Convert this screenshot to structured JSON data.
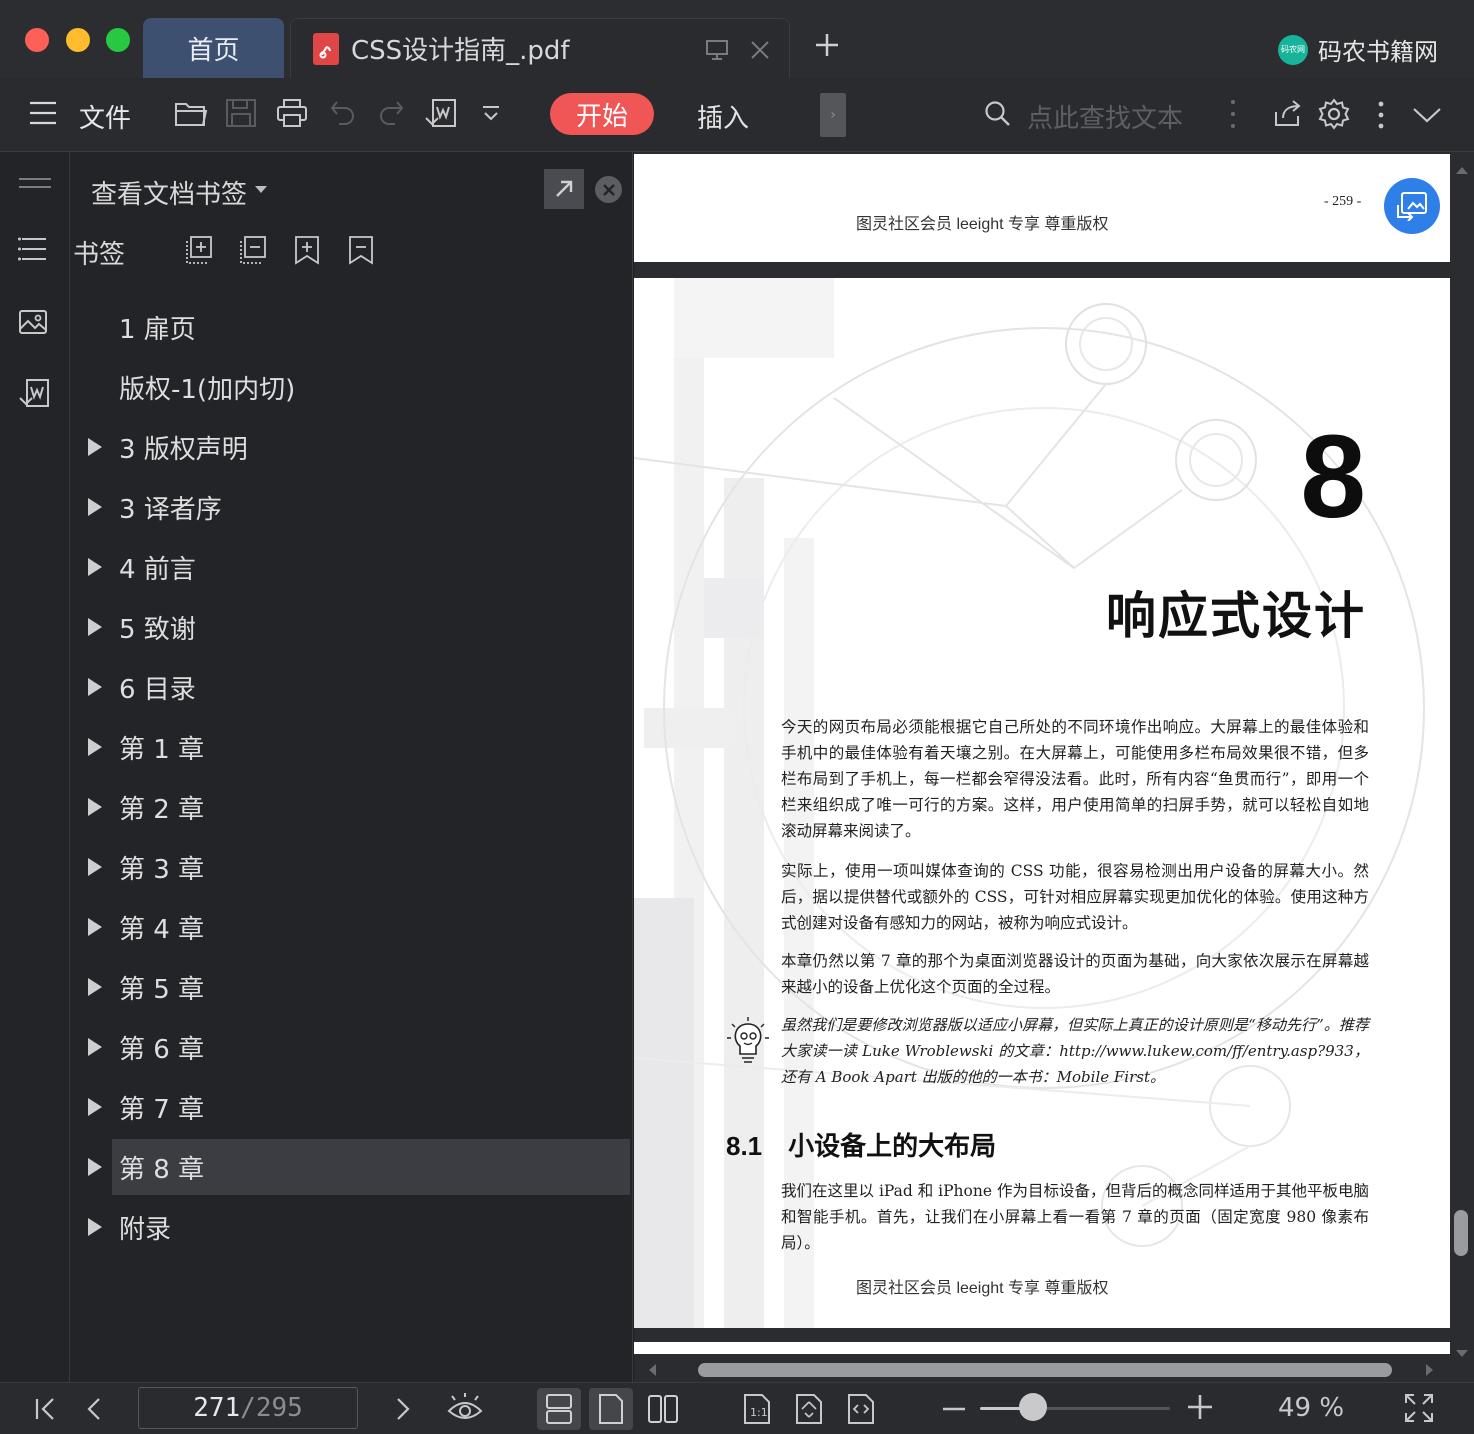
{
  "tabs": {
    "home": "首页",
    "document": "CSS设计指南_.pdf",
    "brand": "码农书籍网",
    "brand_logo_text": "码农网"
  },
  "toolbar": {
    "file_label": "文件",
    "start_label": "开始",
    "insert_label": "插入",
    "more_tab": "›",
    "search_placeholder": "点此查找文本"
  },
  "panel": {
    "title": "查看文档书签",
    "bookmarks_label": "书签",
    "items": [
      {
        "label": "1 扉页",
        "expandable": false,
        "selected": false
      },
      {
        "label": "版权-1(加内切)",
        "expandable": false,
        "selected": false
      },
      {
        "label": "3 版权声明",
        "expandable": true,
        "selected": false
      },
      {
        "label": "3 译者序",
        "expandable": true,
        "selected": false
      },
      {
        "label": "4 前言",
        "expandable": true,
        "selected": false
      },
      {
        "label": "5 致谢",
        "expandable": true,
        "selected": false
      },
      {
        "label": "6 目录",
        "expandable": true,
        "selected": false
      },
      {
        "label": "第 1 章",
        "expandable": true,
        "selected": false
      },
      {
        "label": "第 2 章",
        "expandable": true,
        "selected": false
      },
      {
        "label": "第 3 章",
        "expandable": true,
        "selected": false
      },
      {
        "label": "第 4 章",
        "expandable": true,
        "selected": false
      },
      {
        "label": "第 5 章",
        "expandable": true,
        "selected": false
      },
      {
        "label": "第 6 章",
        "expandable": true,
        "selected": false
      },
      {
        "label": "第 7 章",
        "expandable": true,
        "selected": false
      },
      {
        "label": "第 8 章",
        "expandable": true,
        "selected": true
      },
      {
        "label": "附录",
        "expandable": true,
        "selected": false
      }
    ]
  },
  "document": {
    "header_text": "图灵社区会员 leeight 专享 尊重版权",
    "page_number": "- 259 -",
    "chapter_number": "8",
    "chapter_title": "响应式设计",
    "paragraphs": [
      "今天的网页布局必须能根据它自己所处的不同环境作出响应。大屏幕上的最佳体验和手机中的最佳体验有着天壤之别。在大屏幕上，可能使用多栏布局效果很不错，但多栏布局到了手机上，每一栏都会窄得没法看。此时，所有内容“鱼贯而行”，即用一个栏来组织成了唯一可行的方案。这样，用户使用简单的扫屏手势，就可以轻松自如地滚动屏幕来阅读了。",
      "实际上，使用一项叫媒体查询的 CSS 功能，很容易检测出用户设备的屏幕大小。然后，据以提供替代或额外的 CSS，可针对相应屏幕实现更加优化的体验。使用这种方式创建对设备有感知力的网站，被称为响应式设计。",
      "本章仍然以第 7 章的那个为桌面浏览器设计的页面为基础，向大家依次展示在屏幕越来越小的设备上优化这个页面的全过程。"
    ],
    "note": "虽然我们是要修改浏览器版以适应小屏幕，但实际上真正的设计原则是“移动先行”。推荐大家读一读 Luke Wroblewski 的文章：http://www.lukew.com/ff/entry.asp?933，还有 A Book Apart 出版的他的一本书：Mobile First。",
    "section_number": "8.1",
    "section_title": "小设备上的大布局",
    "section_paragraph": "我们在这里以 iPad 和 iPhone 作为目标设备，但背后的概念同样适用于其他平板电脑和智能手机。首先，让我们在小屏幕上看一看第 7 章的页面（固定宽度 980 像素布局）。",
    "footer_text": "图灵社区会员 leeight 专享 尊重版权"
  },
  "status": {
    "current_page": "271",
    "total_pages": "/295",
    "zoom_label": "49 %",
    "zoom_fraction": 0.28
  },
  "colors": {
    "accent_red": "#f05656",
    "tab_active": "#3d5070",
    "float_button": "#2f7fe8",
    "traffic_close": "#fe5f57",
    "traffic_min": "#febc2e",
    "traffic_max": "#28c840"
  }
}
